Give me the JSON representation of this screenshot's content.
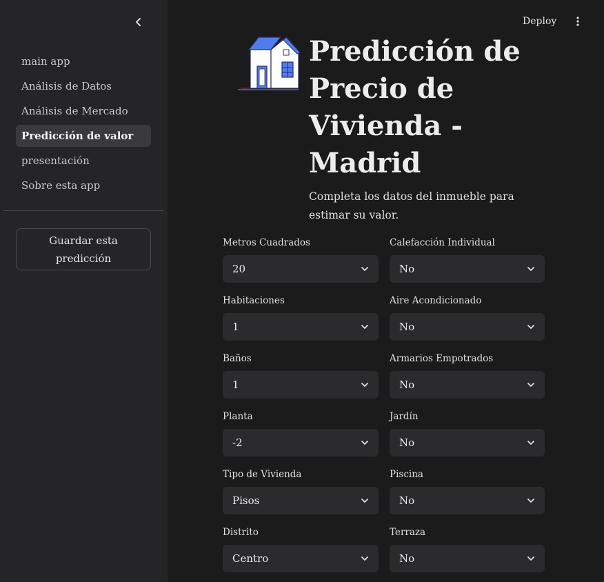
{
  "sidebar": {
    "items": [
      {
        "label": "main app",
        "active": false
      },
      {
        "label": "Análisis de Datos",
        "active": false
      },
      {
        "label": "Análisis de Mercado",
        "active": false
      },
      {
        "label": "Predicción de valor",
        "active": true
      },
      {
        "label": "presentación",
        "active": false
      },
      {
        "label": "Sobre esta app",
        "active": false
      }
    ],
    "save_button": "Guardar esta predicción",
    "collapse_icon": "chevron-left-icon"
  },
  "topbar": {
    "deploy_label": "Deploy",
    "menu_icon": "vertical-dots-icon"
  },
  "main": {
    "title": "Predicción de Precio de Vivienda - Madrid",
    "subtitle": "Completa los datos del inmueble para estimar su valor.",
    "house_icon": "house-icon",
    "fields_left": [
      {
        "label": "Metros Cuadrados",
        "value": "20"
      },
      {
        "label": "Habitaciones",
        "value": "1"
      },
      {
        "label": "Baños",
        "value": "1"
      },
      {
        "label": "Planta",
        "value": "-2"
      },
      {
        "label": "Tipo de Vivienda",
        "value": "Pisos"
      },
      {
        "label": "Distrito",
        "value": "Centro"
      }
    ],
    "fields_right": [
      {
        "label": "Calefacción Individual",
        "value": "No"
      },
      {
        "label": "Aire Acondicionado",
        "value": "No"
      },
      {
        "label": "Armarios Empotrados",
        "value": "No"
      },
      {
        "label": "Jardín",
        "value": "No"
      },
      {
        "label": "Piscina",
        "value": "No"
      },
      {
        "label": "Terraza",
        "value": "No"
      }
    ]
  },
  "colors": {
    "background": "#1b1b1c",
    "sidebar": "#252527",
    "select": "#2b2b2e",
    "accent_blue": "#4f7df0"
  }
}
